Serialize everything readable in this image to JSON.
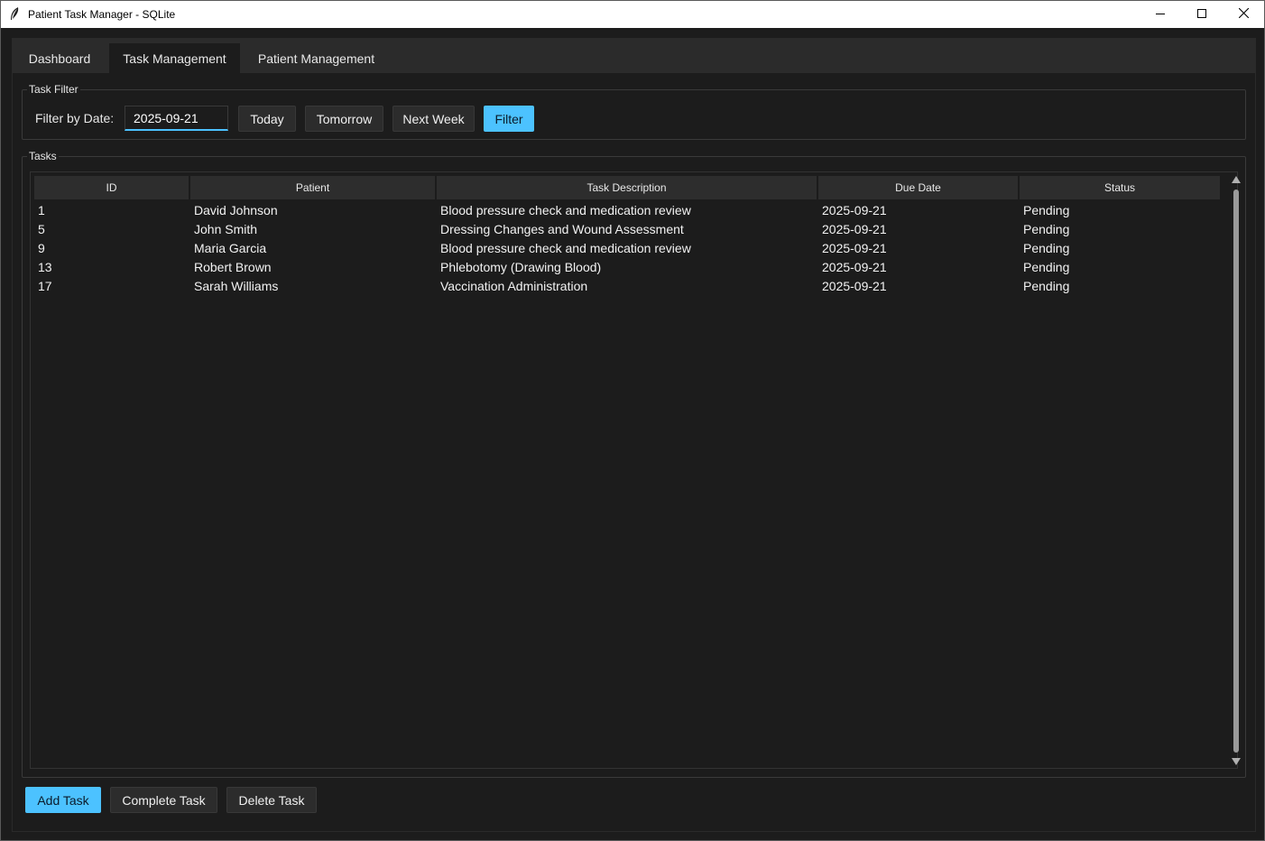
{
  "window": {
    "title": "Patient Task Manager - SQLite",
    "icons": {
      "app": "feather-icon",
      "minimize": "minimize-icon",
      "maximize": "maximize-icon",
      "close": "close-icon"
    }
  },
  "tabs": [
    {
      "label": "Dashboard",
      "active": false
    },
    {
      "label": "Task Management",
      "active": true
    },
    {
      "label": "Patient Management",
      "active": false
    }
  ],
  "filter": {
    "frame_title": "Task Filter",
    "label": "Filter by Date:",
    "date_value": "2025-09-21",
    "today_label": "Today",
    "tomorrow_label": "Tomorrow",
    "next_week_label": "Next Week",
    "filter_label": "Filter"
  },
  "tasks": {
    "frame_title": "Tasks",
    "columns": [
      "ID",
      "Patient",
      "Task Description",
      "Due Date",
      "Status"
    ],
    "rows": [
      {
        "id": "1",
        "patient": "David Johnson",
        "description": "Blood pressure check and medication review",
        "due": "2025-09-21",
        "status": "Pending"
      },
      {
        "id": "5",
        "patient": "John Smith",
        "description": "Dressing Changes and Wound Assessment",
        "due": "2025-09-21",
        "status": "Pending"
      },
      {
        "id": "9",
        "patient": "Maria Garcia",
        "description": "Blood pressure check and medication review",
        "due": "2025-09-21",
        "status": "Pending"
      },
      {
        "id": "13",
        "patient": "Robert Brown",
        "description": "Phlebotomy (Drawing Blood)",
        "due": "2025-09-21",
        "status": "Pending"
      },
      {
        "id": "17",
        "patient": "Sarah Williams",
        "description": "Vaccination Administration",
        "due": "2025-09-21",
        "status": "Pending"
      }
    ]
  },
  "actions": {
    "add_label": "Add Task",
    "complete_label": "Complete Task",
    "delete_label": "Delete Task"
  },
  "colors": {
    "accent": "#4cc2ff",
    "background": "#1c1c1c",
    "tabbar": "#2b2b2b"
  }
}
